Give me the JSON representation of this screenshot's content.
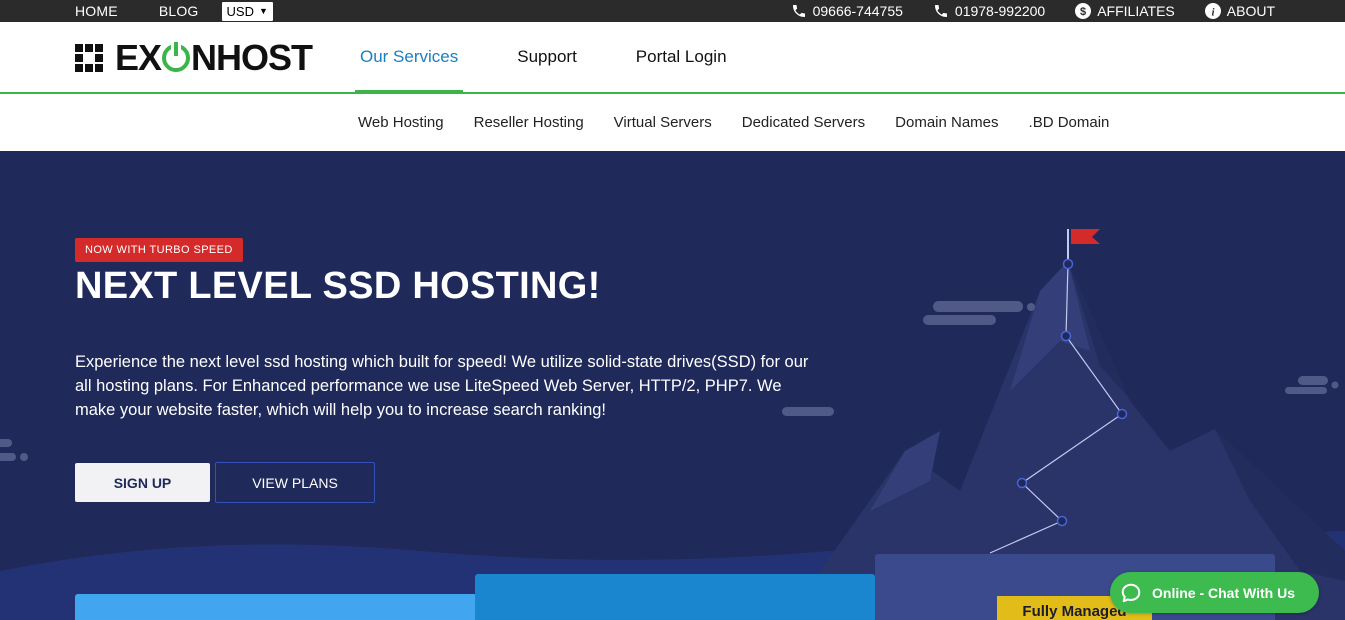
{
  "topbar": {
    "home": "HOME",
    "blog": "BLOG",
    "currency": "USD",
    "phone1": "09666-744755",
    "phone2": "01978-992200",
    "affiliates": "AFFILIATES",
    "about": "ABOUT"
  },
  "logo": {
    "part1": "EX",
    "part2": "NHOST"
  },
  "mainnav": [
    "Our Services",
    "Support",
    "Portal Login"
  ],
  "subnav": [
    "Web Hosting",
    "Reseller Hosting",
    "Virtual Servers",
    "Dedicated Servers",
    "Domain Names",
    ".BD Domain"
  ],
  "hero": {
    "badge": "NOW WITH TURBO SPEED",
    "title": "NEXT LEVEL SSD HOSTING!",
    "description": "Experience the next level ssd hosting which built for speed! We utilize solid-state drives(SSD) for our all hosting plans. For Enhanced performance we use LiteSpeed Web Server, HTTP/2, PHP7. We make your website faster, which will help you to increase search ranking!",
    "signup": "SIGN UP",
    "view_plans": "VIEW PLANS"
  },
  "cards": {
    "managed_label": "Fully Managed"
  },
  "chat": {
    "label": "Online - Chat With Us"
  },
  "colors": {
    "green": "#3bb54a",
    "navy": "#1f2a5a",
    "badge_red": "#d42a2a",
    "link_blue": "#1a7fc0"
  }
}
